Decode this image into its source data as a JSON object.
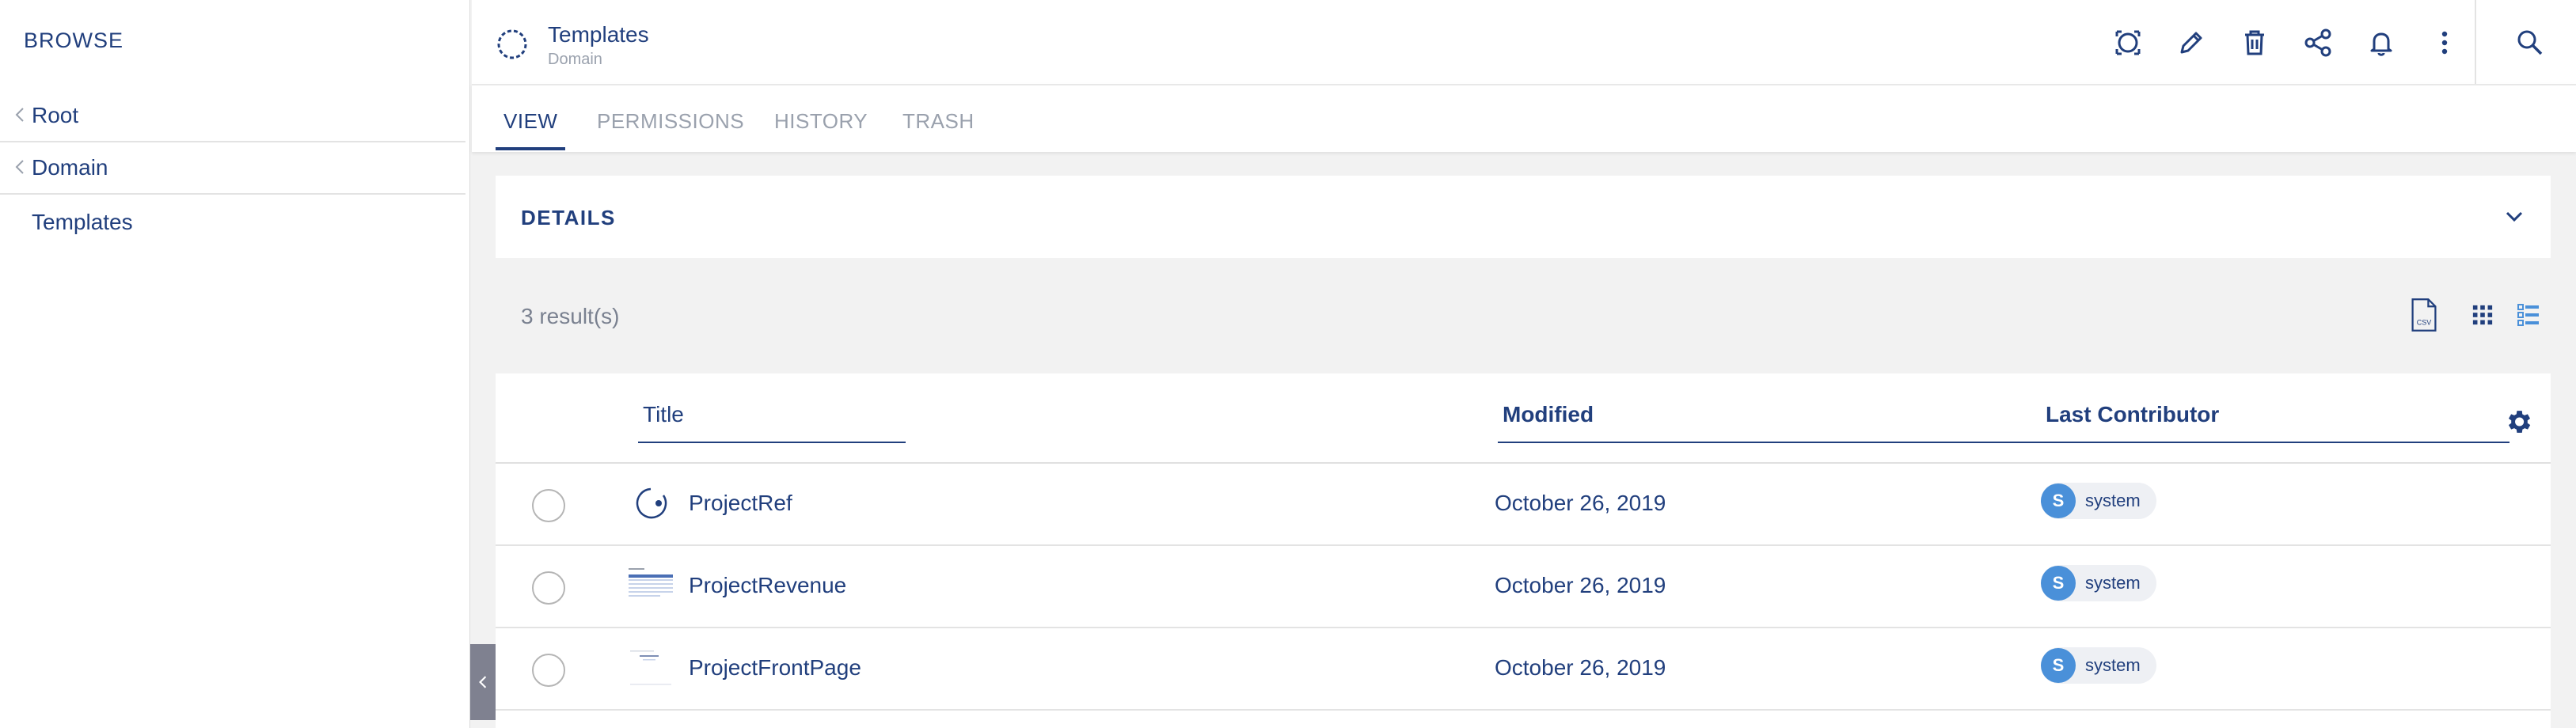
{
  "sidebar": {
    "title": "BROWSE",
    "tree": [
      {
        "label": "Root",
        "has_chevron": true
      },
      {
        "label": "Domain",
        "has_chevron": true
      },
      {
        "label": "Templates",
        "has_chevron": false
      }
    ]
  },
  "header": {
    "title": "Templates",
    "type": "Domain",
    "actions": [
      "slideshow-icon",
      "edit-icon",
      "delete-icon",
      "share-icon",
      "notification-bell-icon",
      "more-vert-icon",
      "search-icon"
    ]
  },
  "tabs": [
    {
      "label": "VIEW",
      "active": true
    },
    {
      "label": "PERMISSIONS",
      "active": false
    },
    {
      "label": "HISTORY",
      "active": false
    },
    {
      "label": "TRASH",
      "active": false
    }
  ],
  "details": {
    "label": "DETAILS"
  },
  "results": {
    "count_text": "3 result(s)",
    "views": [
      "csv-export-icon",
      "grid-view-icon",
      "list-view-icon"
    ]
  },
  "table": {
    "columns": {
      "title": "Title",
      "modified": "Modified",
      "last_contributor": "Last Contributor"
    },
    "rows": [
      {
        "title": "ProjectRef",
        "modified": "October 26, 2019",
        "contributor": "system",
        "initial": "S",
        "thumb": "template-icon"
      },
      {
        "title": "ProjectRevenue",
        "modified": "October 26, 2019",
        "contributor": "system",
        "initial": "S",
        "thumb": "document-thumbnail"
      },
      {
        "title": "ProjectFrontPage",
        "modified": "October 26, 2019",
        "contributor": "system",
        "initial": "S",
        "thumb": "document-thumbnail"
      }
    ]
  },
  "colors": {
    "primary": "#213f7d",
    "muted": "#9aa1ad",
    "accent": "#4a90d9",
    "avatar": "#4a90d9"
  }
}
